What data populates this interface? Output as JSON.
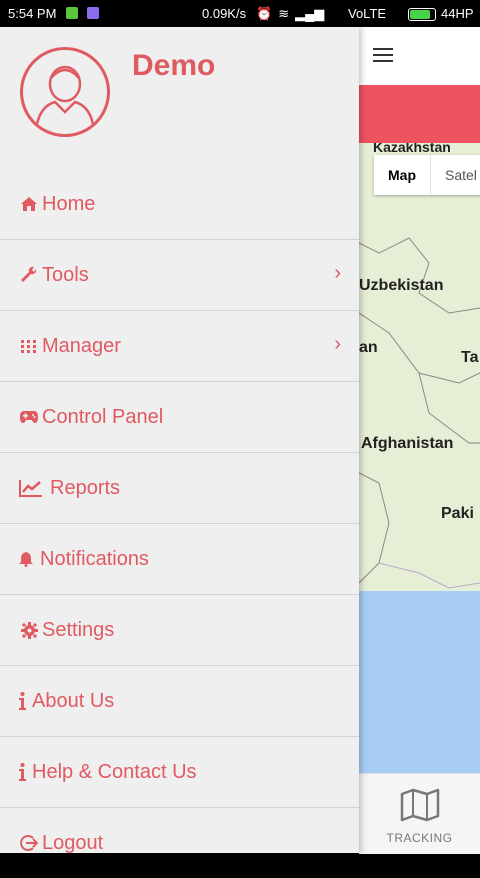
{
  "status_bar": {
    "time": "5:54 PM",
    "speed": "0.09K/s",
    "network": "VoLTE",
    "battery": "44HP"
  },
  "drawer": {
    "username": "Demo",
    "items": [
      {
        "label": "Home",
        "icon": "home-icon",
        "has_submenu": false
      },
      {
        "label": "Tools",
        "icon": "wrench-icon",
        "has_submenu": true
      },
      {
        "label": "Manager",
        "icon": "grid-icon",
        "has_submenu": true
      },
      {
        "label": "Control Panel",
        "icon": "gamepad-icon",
        "has_submenu": false
      },
      {
        "label": "Reports",
        "icon": "chart-icon",
        "has_submenu": false
      },
      {
        "label": "Notifications",
        "icon": "bell-icon",
        "has_submenu": false
      },
      {
        "label": "Settings",
        "icon": "gear-icon",
        "has_submenu": false
      },
      {
        "label": "About Us",
        "icon": "info-icon",
        "has_submenu": false
      },
      {
        "label": "Help & Contact Us",
        "icon": "info-icon",
        "has_submenu": false
      },
      {
        "label": "Logout",
        "icon": "logout-icon",
        "has_submenu": false
      }
    ],
    "accent_color": "#e05a62"
  },
  "map": {
    "toggle": {
      "map_label": "Map",
      "satellite_label": "Satel"
    },
    "places": [
      "Uzbekistan",
      "an",
      "Ta",
      "Afghanistan",
      "Paki",
      "Kazakhstan"
    ]
  },
  "bottom_nav": {
    "tracking_label": "TRACKING"
  },
  "colors": {
    "header_red": "#ef5360",
    "drawer_bg": "#efefef"
  }
}
